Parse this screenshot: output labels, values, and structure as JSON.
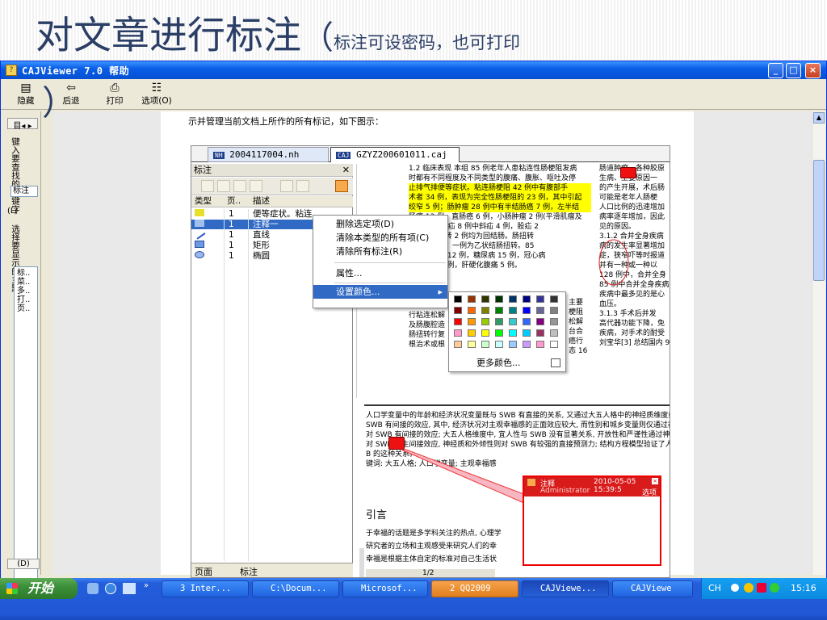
{
  "slide": {
    "title_main": "对文章进行标注",
    "title_paren_open": "（",
    "title_sub": "标注可设密码，也可打印",
    "title_paren_close": "）"
  },
  "window": {
    "title": "CAJViewer 7.0 帮助",
    "controls": {
      "minimize": "_",
      "maximize": "□",
      "close": "×"
    }
  },
  "toolbar": {
    "hide": "隐藏",
    "back": "后退",
    "print": "打印",
    "options": "选项(O)"
  },
  "leftpanel": {
    "tab_nav": "目◂ ▸",
    "keyword_label": "键入要查找的关键字",
    "keyword_input": "标注",
    "list_l": "(L)",
    "topic_label": "选择要显示的主题",
    "topics": [
      "标..",
      "菜..",
      "多..",
      "打..",
      "页.."
    ],
    "display_d": "(D)"
  },
  "help_text": "示并管理当前文档上所作的所有标记，如下图示：",
  "inner": {
    "tab1": "2004117004.nh",
    "tab2": "GZYZ200601011.caj",
    "annot_title": "标注",
    "col_type": "类型",
    "col_page": "页..",
    "col_desc": "描述",
    "rows": [
      {
        "page": "1",
        "desc": "便等症状。粘连..."
      },
      {
        "page": "1",
        "desc": "注释一"
      },
      {
        "page": "1",
        "desc": "直线"
      },
      {
        "page": "1",
        "desc": "矩形"
      },
      {
        "page": "1",
        "desc": "椭圆"
      }
    ],
    "bottom_tab_pages": "页面",
    "bottom_tab_annot": "标注",
    "context_menu": {
      "delete_selected": "删除选定项(D)",
      "clear_type": "清除本类型的所有项(C)",
      "clear_all": "清除所有标注(R)",
      "properties": "属性...",
      "set_color": "设置颜色..."
    },
    "more_colors": "更多颜色...",
    "colors": [
      "#000000",
      "#993300",
      "#333300",
      "#003300",
      "#003366",
      "#000080",
      "#333399",
      "#333333",
      "#800000",
      "#ff6600",
      "#808000",
      "#008000",
      "#008080",
      "#0000ff",
      "#666699",
      "#808080",
      "#ff0000",
      "#ff9900",
      "#99cc00",
      "#339966",
      "#33cccc",
      "#3366ff",
      "#800080",
      "#969696",
      "#ff99cc",
      "#ffcc00",
      "#ffff00",
      "#00ff00",
      "#00ffff",
      "#00ccff",
      "#993366",
      "#c0c0c0",
      "#ffcc99",
      "#ffff99",
      "#ccffcc",
      "#ccffff",
      "#99ccff",
      "#cc99ff",
      "#ff99cc",
      "#ffffff"
    ],
    "doc_lines_left": [
      "1.2  临床表现   本组 85 例老年人患粘连性肠梗阻发病",
      "时都有不同程度及不同类型的腹痛、腹胀、呕吐及停",
      "止排气排便等症状。粘连肠梗阻 42 例中有腹部手",
      "术者 34 例，表现为完全性肠梗阻的 23 例，其中引起",
      "绞窄 5 例；肠肿瘤 28 例中有半结肠癌 7 例，左半结",
      "肠癌 13 例，直肠癌 6 例，小肠肿瘤 2 例(平滑肌瘤及",
      "腺癌)。嵌顿疝 8 例中斜疝 4 例，股疝 2",
      "2 例。肠扭转 2 例均为回结肠。肠扭转",
      "为小肠扭转，一例为乙状结肠扭转。85",
      "合并高血压 12 例，糖尿病 15 例，冠心病",
      "支气管炎 8 例，肝硬化腹痛 5 例。"
    ],
    "doc_lines_right": [
      "肠道肿瘤、各种胶原",
      "生病、主要原因一",
      "的产生开展，术后肠",
      "可能是老年人肠梗",
      "人口比例的迅速增加",
      "病率逐年增加，因此",
      "见的原因。",
      "3.1.2  合并全身疾病",
      "病的发生率显著增加",
      "症，狭窄吓等时报道",
      "并有一种或一种以",
      "128 例中，合并全身",
      "85 例中合并全身疾病",
      "疾病中最多见的是心",
      "血压。",
      "3.1.3  手术后并发",
      "高代器功能下降，免",
      "疾病，对手术的耐受",
      "刘宝华[3] 总结国内 9"
    ],
    "doc_lines_left2": [
      "为粘连肠梗",
      "行粘连松解",
      "及肠腹腔造",
      "肠扭转行复",
      "根治术或根"
    ],
    "doc_lines_right2": [
      "主要",
      "梗阻",
      "松解",
      "台合",
      "癌行",
      "态 16"
    ],
    "doc2_lines": [
      "人口学变量中的年龄和经济状况变量既与 SWB 有直接的关系, 又通过大五人格中的神经质维度或",
      "SWB 有间接的效应, 其中, 经济状况对主观幸福感的正面效应较大, 而性别和城乡变量则仅通过神经",
      "对 SWB 有间接的效应; 大五人格维度中, 宜人性与 SWB 没有显著关系, 开放性和严谨性通过神经",
      "对 SWB 产生间接效应, 神经质和外倾性则对 SWB 有较强的直接预测力; 结构方程模型验证了人格",
      "B 的这种关系。",
      "键词: 大五人格; 人口学变量; 主观幸福感"
    ],
    "doc2_heading": "引言",
    "doc2_body": [
      "于幸福的话题是多学科关注的热点, 心理学",
      "研究者的立场和主观感受来研究人们的幸",
      "幸福是根据主体自定的标准对自己生活状"
    ],
    "page_indicator": "1/2",
    "note": {
      "title": "注释",
      "timestamp": "2010-05-05 15:39:5",
      "author": "Administrator",
      "options": "选项"
    }
  },
  "taskbar": {
    "start": "开始",
    "tasks": [
      "3 Inter...",
      "C:\\Docum...",
      "Microsof...",
      "2 QQ2009",
      "CAJViewe...",
      "CAJViewe"
    ],
    "ime": "CH",
    "clock": "15:16"
  }
}
